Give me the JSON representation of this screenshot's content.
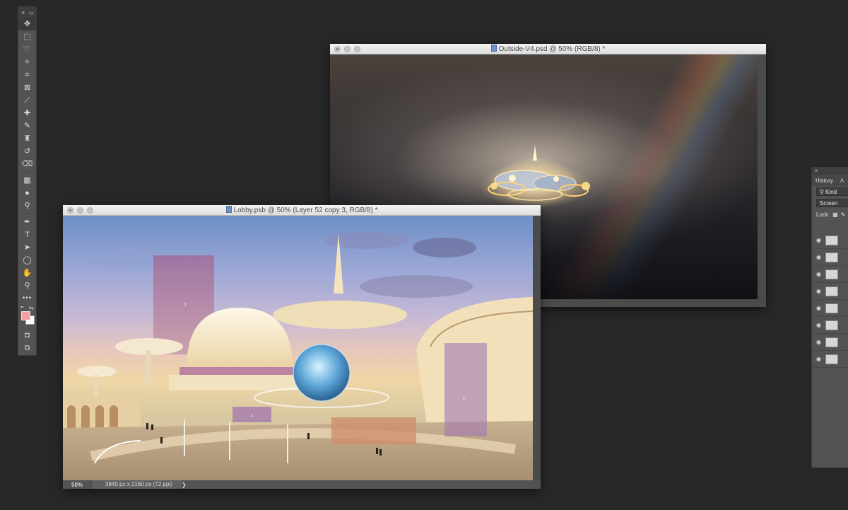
{
  "toolbar": {
    "close": "×",
    "collapse": "››",
    "tools": [
      {
        "name": "move-tool",
        "glyph": "✥",
        "active": true
      },
      {
        "name": "marquee-tool",
        "glyph": "⬚"
      },
      {
        "name": "lasso-tool",
        "glyph": "➰"
      },
      {
        "name": "magic-wand-tool",
        "glyph": "✧"
      },
      {
        "name": "crop-tool",
        "glyph": "⌗"
      },
      {
        "name": "frame-tool",
        "glyph": "⊠"
      },
      {
        "name": "eyedropper-tool",
        "glyph": "⟋"
      },
      {
        "name": "healing-brush-tool",
        "glyph": "✚"
      },
      {
        "name": "brush-tool",
        "glyph": "✎"
      },
      {
        "name": "clone-stamp-tool",
        "glyph": "♜"
      },
      {
        "name": "history-brush-tool",
        "glyph": "↺"
      },
      {
        "name": "eraser-tool",
        "glyph": "⌫"
      },
      {
        "name": "gradient-tool",
        "glyph": "▦"
      },
      {
        "name": "blur-tool",
        "glyph": "●"
      },
      {
        "name": "dodge-tool",
        "glyph": "⚲"
      },
      {
        "name": "pen-tool",
        "glyph": "✒"
      },
      {
        "name": "type-tool",
        "glyph": "T"
      },
      {
        "name": "path-selection-tool",
        "glyph": "➤"
      },
      {
        "name": "shape-tool",
        "glyph": "◯"
      },
      {
        "name": "hand-tool",
        "glyph": "✋"
      },
      {
        "name": "zoom-tool",
        "glyph": "⚲"
      }
    ],
    "more": "•••",
    "foreground_color": "#f6a0a4",
    "background_color": "#ffffff",
    "quick_mask": "◘",
    "screen_mode": "⧉"
  },
  "outside_window": {
    "title": "Outside-V4.psd @ 50% (RGB/8) *"
  },
  "lobby_window": {
    "title": "Lobby.psb @ 50% (Layer 52 copy 3, RGB/8) *",
    "zoom": "50%",
    "doc_info": "3840 px x 2160 px (72 ppi)",
    "info_arrow": "❯"
  },
  "canvas_labels": {
    "tower_label": "1",
    "banner_label_3": "3",
    "banner_label_5": "5"
  },
  "layers_panel": {
    "close": "×",
    "tab_history": "History",
    "tab_second": "A",
    "filter": "Kind",
    "blend_mode": "Screen",
    "lock_label": "Lock:"
  },
  "colors": {
    "app_bg": "#282828",
    "panel": "#535353"
  }
}
